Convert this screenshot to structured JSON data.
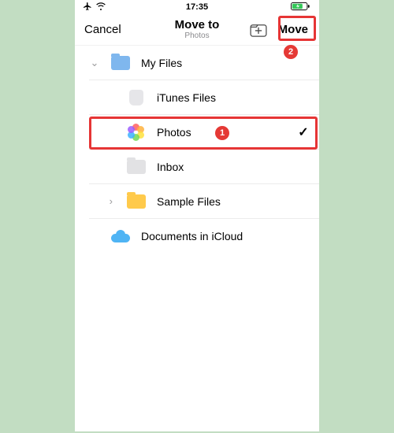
{
  "status": {
    "time": "17:35"
  },
  "nav": {
    "cancel": "Cancel",
    "title": "Move to",
    "subtitle": "Photos",
    "move": "Move"
  },
  "badges": {
    "one": "1",
    "two": "2"
  },
  "list": {
    "myfiles": "My Files",
    "itunes": "iTunes Files",
    "photos": "Photos",
    "inbox": "Inbox",
    "sample": "Sample Files",
    "icloud": "Documents in iCloud"
  }
}
